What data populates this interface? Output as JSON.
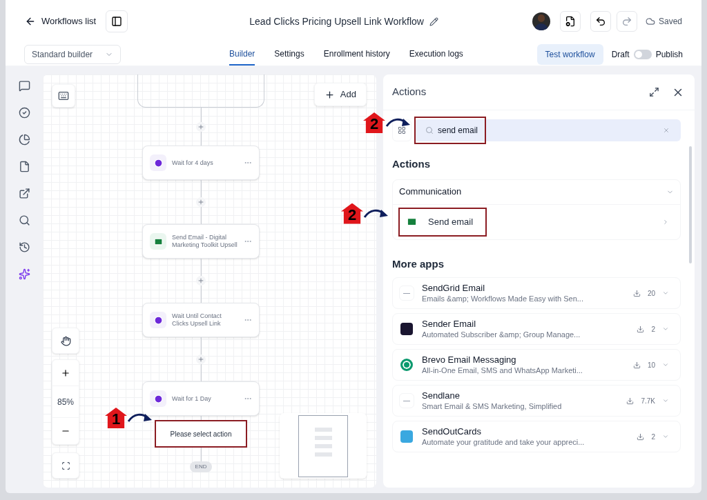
{
  "header": {
    "back_label": "Workflows list",
    "title": "Lead Clicks Pricing Upsell Link Workflow",
    "save_status": "Saved",
    "redo_disabled": true
  },
  "builder_select": {
    "value": "Standard builder"
  },
  "tabs": [
    {
      "label": "Builder",
      "selected": true
    },
    {
      "label": "Settings",
      "selected": false
    },
    {
      "label": "Enrollment history",
      "selected": false
    },
    {
      "label": "Execution logs",
      "selected": false
    }
  ],
  "test_button": "Test workflow",
  "publish_toggle": {
    "off_label": "Draft",
    "on_label": "Publish",
    "on": false
  },
  "rail": [
    {
      "selected": false
    },
    {
      "selected": false
    },
    {
      "selected": false
    },
    {
      "selected": false
    },
    {
      "selected": false
    },
    {
      "selected": false
    },
    {
      "selected": false
    },
    {
      "selected": true
    }
  ],
  "canvas": {
    "add_button": "Add",
    "zoom": "85%",
    "end_label": "END",
    "nodes": [
      {
        "kind": "wait",
        "label": "Wait for 4 days"
      },
      {
        "kind": "email",
        "label": "Send Email - Digital Marketing Toolkit Upsell"
      },
      {
        "kind": "wait",
        "label": "Wait Until Contact Clicks Upsell Link"
      },
      {
        "kind": "wait",
        "label": "Wait for 1 Day"
      },
      {
        "kind": "pending",
        "label": "Please select action",
        "highlighted": true,
        "callout": "1"
      }
    ]
  },
  "panel": {
    "title": "Actions",
    "search": {
      "value": "send email",
      "highlighted": true,
      "callout": "2"
    },
    "actions_heading": "Actions",
    "group": {
      "title": "Communication",
      "expanded": true,
      "items": [
        {
          "label": "Send email",
          "highlighted": true,
          "callout": "2"
        }
      ]
    },
    "more_heading": "More apps",
    "apps": [
      {
        "kind": "light",
        "name": "SendGrid Email",
        "description": "Emails &amp; Workflows Made Easy with Sen...",
        "installs": "20"
      },
      {
        "kind": "dark",
        "name": "Sender Email",
        "description": "Automated Subscriber &amp; Group Manage...",
        "installs": "2"
      },
      {
        "kind": "green",
        "name": "Brevo Email Messaging",
        "description": "All-in-One Email, SMS and WhatsApp Marketi...",
        "installs": "10"
      },
      {
        "kind": "light",
        "name": "Sendlane",
        "description": "Smart Email & SMS Marketing, Simplified",
        "installs": "7.7K"
      },
      {
        "kind": "blue",
        "name": "SendOutCards",
        "description": "Automate your gratitude and take your appreci...",
        "installs": "2"
      }
    ]
  }
}
